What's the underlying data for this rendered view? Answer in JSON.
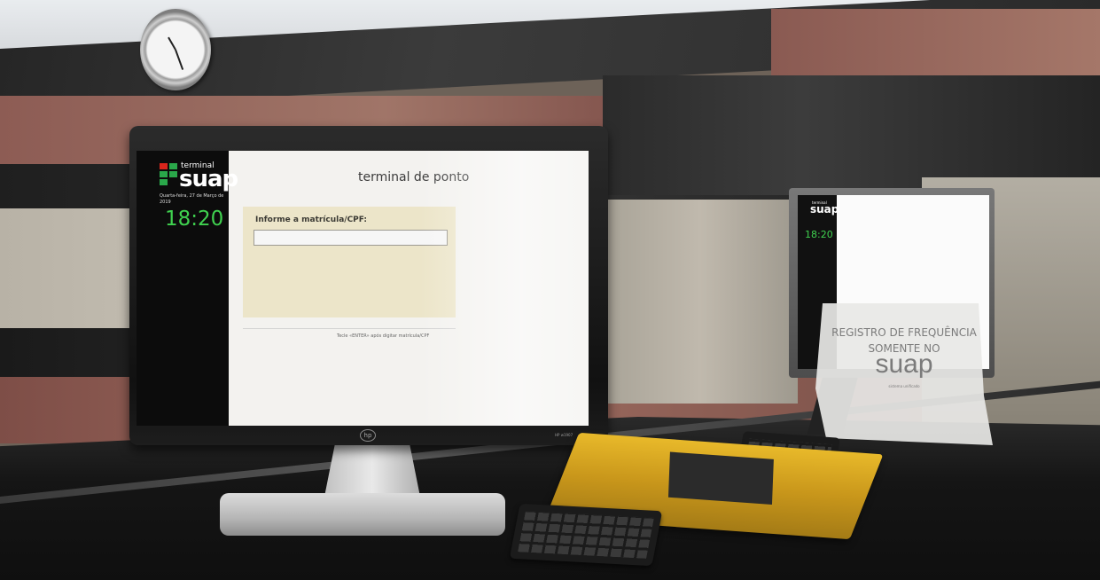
{
  "terminal": {
    "logo_small": "terminal",
    "logo_big": "suap",
    "date_text": "Quarta-feira, 27 de Março de 2019",
    "time": "18:20",
    "title": "terminal de ponto",
    "form_label": "Informe a matrícula/CPF:",
    "input_value": "",
    "hint": "Tecle «ENTER» após digitar matrícula/CPF",
    "bezel_logo": "hp",
    "model": "HP w1907"
  },
  "small_terminal": {
    "logo_small": "terminal",
    "logo_big": "suap",
    "time": "18:20"
  },
  "sign": {
    "line1": "REGISTRO DE FREQUÊNCIA",
    "line2": "SOMENTE NO",
    "logo": "suap",
    "subtitle": "sistema unificado"
  },
  "colors": {
    "accent_green": "#3fd14f",
    "logo_red": "#d9261c",
    "form_panel": "#ece5c9"
  }
}
